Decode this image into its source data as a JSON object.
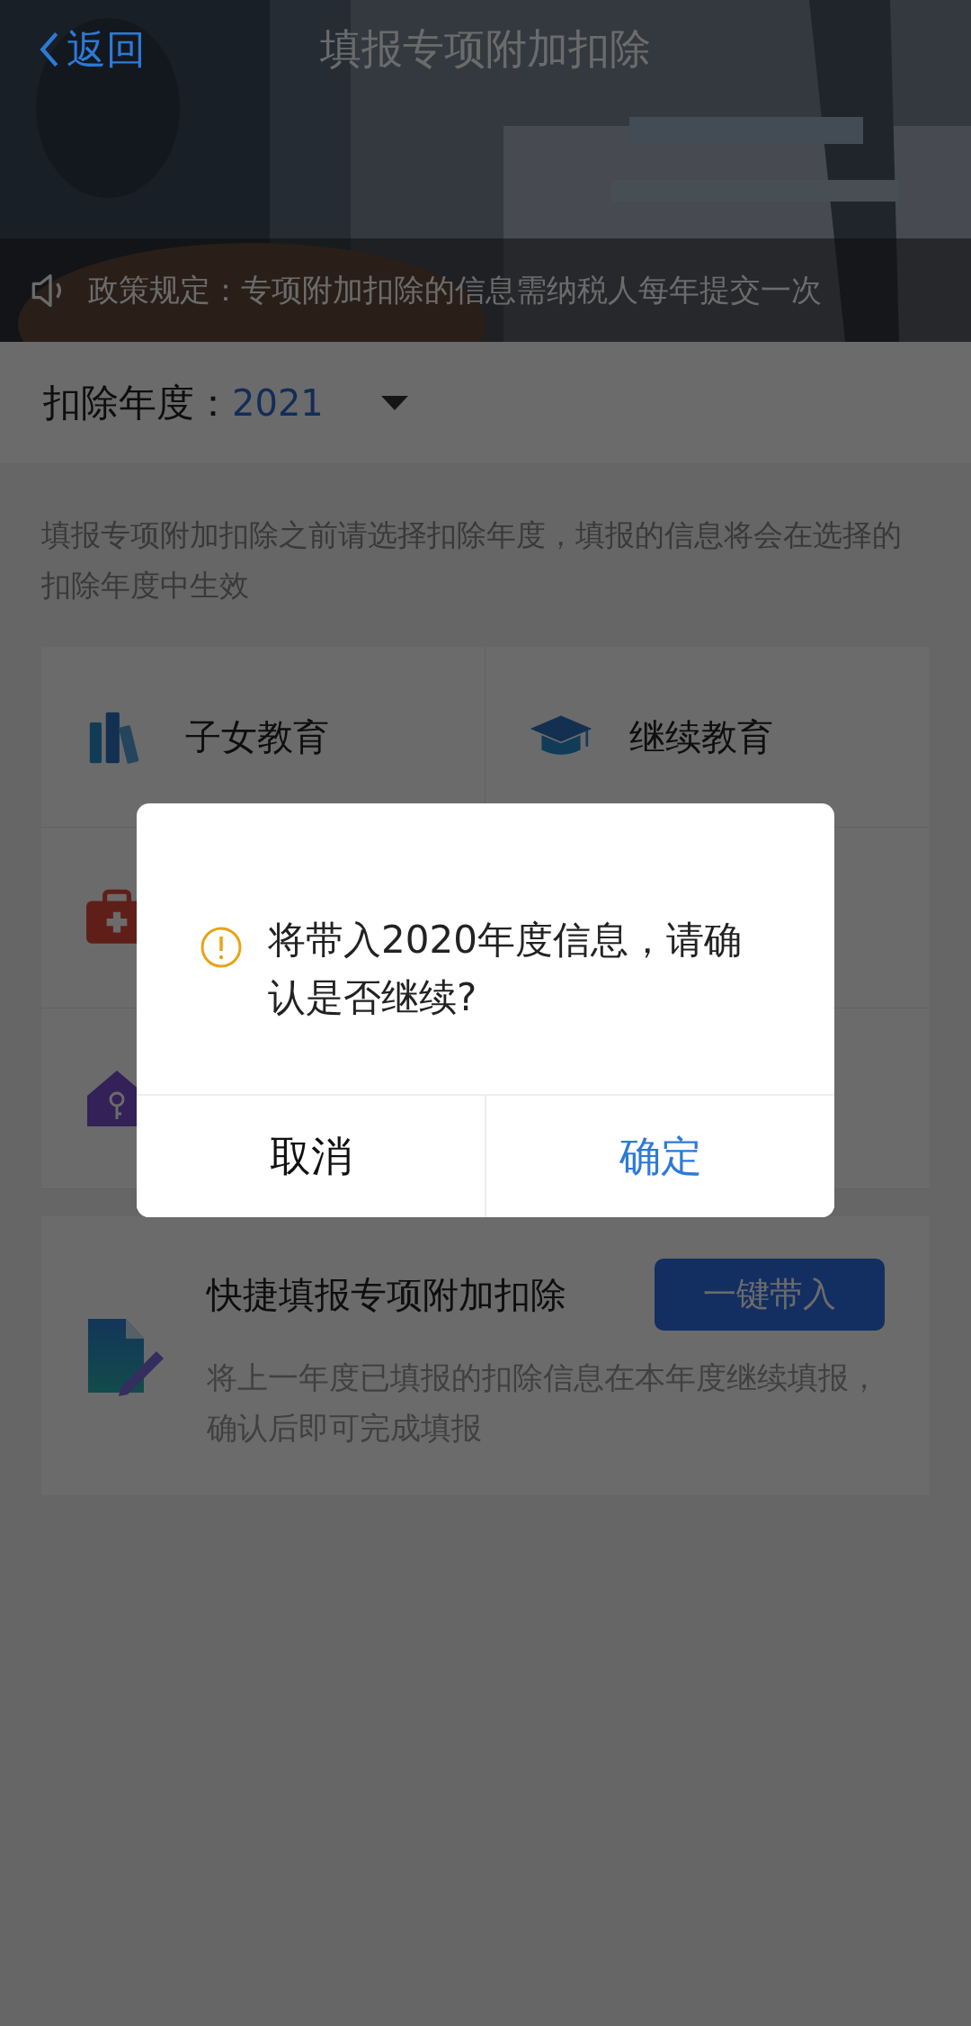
{
  "nav": {
    "back": "返回",
    "title": "填报专项附加扣除"
  },
  "notice": "政策规定：专项附加扣除的信息需纳税人每年提交一次",
  "year": {
    "label": "扣除年度：",
    "value": "2021"
  },
  "description": "填报专项附加扣除之前请选择扣除年度，填报的信息将会在选择的扣除年度中生效",
  "grid": [
    {
      "kind": "books",
      "label": "子女教育"
    },
    {
      "kind": "cap",
      "label": "继续教育"
    },
    {
      "kind": "medkit"
    },
    {
      "kind": "none"
    },
    {
      "kind": "house"
    },
    {
      "kind": "none"
    }
  ],
  "quick": {
    "title": "快捷填报专项附加扣除",
    "button": "一键带入",
    "text": "将上一年度已填报的扣除信息在本年度继续填报，确认后即可完成填报"
  },
  "dialog": {
    "message": "将带入2020年度信息，请确认是否继续?",
    "buttons": [
      {
        "label": "取消",
        "kind": "cancel"
      },
      {
        "label": "确定",
        "kind": "confirm"
      }
    ]
  }
}
